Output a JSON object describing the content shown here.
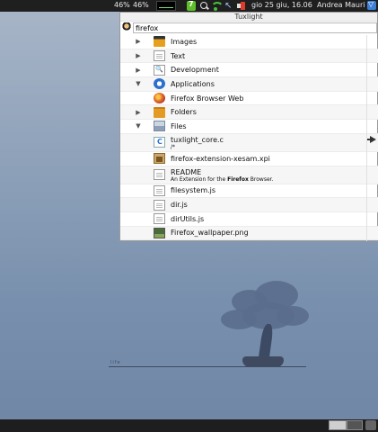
{
  "top_panel": {
    "battery1": "46%",
    "battery2": "46%",
    "datetime": "gio 25 giu, 16.06",
    "user": "Andrea Mauri",
    "icons": [
      "cpu-graph-icon",
      "updates-icon",
      "search-icon",
      "wifi-icon",
      "cursor-icon",
      "volume-icon",
      "user-menu-icon"
    ]
  },
  "launcher": {
    "title": "Tuxlight",
    "search": {
      "value": "firefox",
      "placeholder": ""
    },
    "rows": [
      {
        "label": "Images",
        "expander": "▶",
        "icon": "images-icon"
      },
      {
        "label": "Text",
        "expander": "▶",
        "icon": "text-icon"
      },
      {
        "label": "Development",
        "expander": "▶",
        "icon": "development-icon"
      },
      {
        "label": "Applications",
        "expander": "▼",
        "icon": "applications-icon"
      },
      {
        "label": "Firefox Browser Web",
        "expander": "",
        "icon": "firefox-icon"
      },
      {
        "label": "Folders",
        "expander": "▶",
        "icon": "folder-icon"
      },
      {
        "label": "Files",
        "expander": "▼",
        "icon": "files-icon"
      },
      {
        "label": "tuxlight_core.c",
        "sub": "/*",
        "icon": "c-file-icon"
      },
      {
        "label": "firefox-extension-xesam.xpi",
        "icon": "xpi-file-icon"
      },
      {
        "label": "README",
        "sub_pre": "An Extension for the ",
        "sub_bold": "Firefox",
        "sub_post": " Browser.",
        "icon": "readme-file-icon"
      },
      {
        "label": "filesystem.js",
        "icon": "js-file-icon"
      },
      {
        "label": "dir.js",
        "icon": "js-file-icon"
      },
      {
        "label": "dirUtils.js",
        "icon": "js-file-icon"
      },
      {
        "label": "Firefox_wallpaper.png",
        "icon": "png-file-icon"
      }
    ]
  },
  "desktop": {
    "wallpaper_caption": "life"
  }
}
